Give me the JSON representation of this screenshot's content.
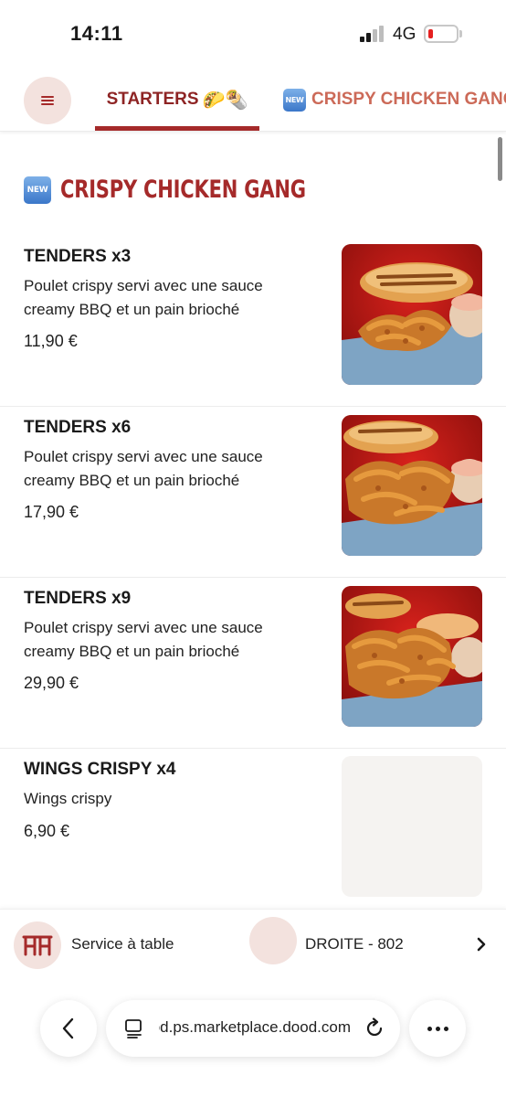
{
  "status_bar": {
    "time": "14:11",
    "network": "4G"
  },
  "nav": {
    "tabs": [
      {
        "label": "STARTERS",
        "emoji": "🌮🌯",
        "active": true
      },
      {
        "badge": "NEW",
        "label": "CRISPY CHICKEN GANG",
        "active": false
      }
    ]
  },
  "section": {
    "badge": "NEW",
    "title": "CRISPY CHICKEN GANG"
  },
  "items": [
    {
      "name": "TENDERS x3",
      "description": "Poulet crispy servi avec une sauce creamy BBQ et un pain brioché",
      "price": "11,90 €",
      "image": "chicken-tenders-photo"
    },
    {
      "name": "TENDERS x6",
      "description": "Poulet crispy servi avec une sauce creamy BBQ et un pain brioché",
      "price": "17,90 €",
      "image": "chicken-tenders-photo"
    },
    {
      "name": "TENDERS x9",
      "description": "Poulet crispy servi avec une sauce creamy BBQ et un pain brioché",
      "price": "29,90 €",
      "image": "chicken-tenders-photo"
    },
    {
      "name": "WINGS CRISPY x4",
      "description": "Wings crispy",
      "price": "6,90 €",
      "image": "image-placeholder"
    }
  ],
  "bottom_bar": {
    "service_label": "Service à table",
    "table_label": "DROITE - 802"
  },
  "browser": {
    "url": "dood.ps.marketplace.dood.com"
  },
  "colors": {
    "accent": "#a52a2a",
    "accent_light": "#f3e2de",
    "tab_inactive": "#cc6a58",
    "badge_blue": "#3b77c9"
  }
}
